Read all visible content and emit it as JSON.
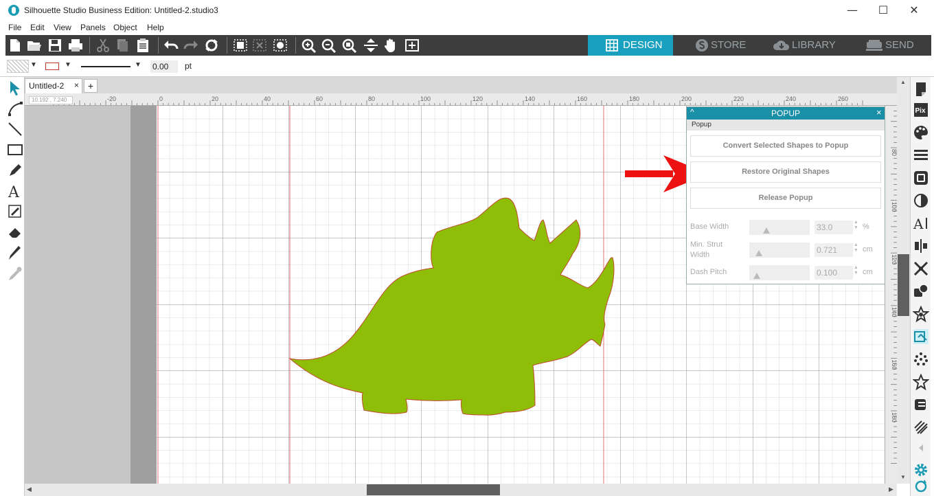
{
  "window": {
    "title": "Silhouette Studio Business Edition: Untitled-2.studio3",
    "minimize": "—",
    "maximize": "☐",
    "close": "✕"
  },
  "menu": [
    "File",
    "Edit",
    "View",
    "Panels",
    "Object",
    "Help"
  ],
  "nav_tabs": [
    {
      "label": "DESIGN",
      "active": true
    },
    {
      "label": "STORE",
      "active": false
    },
    {
      "label": "LIBRARY",
      "active": false
    },
    {
      "label": "SEND",
      "active": false
    }
  ],
  "propbar": {
    "line_width_value": "0.00",
    "line_width_unit": "pt"
  },
  "document_tab": {
    "label": "Untitled-2",
    "close": "×",
    "add": "+"
  },
  "coords": "10.192 , 7.240",
  "ruler_h_labels": [
    "-20",
    "0",
    "20",
    "40",
    "60",
    "80",
    "100",
    "120",
    "140",
    "160",
    "180",
    "200",
    "220",
    "240",
    "260"
  ],
  "ruler_v_labels": [
    "80",
    "100",
    "120",
    "140",
    "160",
    "180"
  ],
  "popup": {
    "title": "POPUP",
    "collapse": "^",
    "close": "×",
    "section_label": "Popup",
    "buttons": [
      "Convert Selected Shapes to Popup",
      "Restore Original Shapes",
      "Release Popup"
    ],
    "fields": [
      {
        "label": "Base Width",
        "value": "33.0",
        "unit": "%",
        "level": 0.28
      },
      {
        "label": "Min. Strut Width",
        "value": "0.721",
        "unit": "cm",
        "level": 0.16
      },
      {
        "label": "Dash Pitch",
        "value": "0.100",
        "unit": "cm",
        "level": 0.13
      }
    ]
  },
  "colors": {
    "toolbar": "#3d3d3d",
    "accent": "#1aa0bf",
    "shape_fill": "#8fbe08",
    "shape_stroke": "#c0492c",
    "annotation_arrow": "#ee1111"
  }
}
